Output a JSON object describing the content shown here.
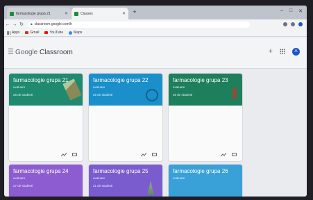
{
  "browser": {
    "tabs": [
      {
        "label": "farmacologie grupa 21",
        "active": false
      },
      {
        "label": "Classes",
        "active": true
      }
    ],
    "url": "classroom.google.com/h",
    "bookmarks": [
      "Apps",
      "Gmail",
      "YouTube",
      "Maps"
    ]
  },
  "header": {
    "app_name_google": "Google",
    "app_name_product": "Classroom",
    "avatar_letter": "A"
  },
  "classes": [
    {
      "title": "farmacologie grupa 21",
      "section": "evaluare",
      "count": "26 de studenti",
      "color": "#1f8a6f"
    },
    {
      "title": "farmacologie grupa 22",
      "section": "evaluare",
      "count": "26 de studenti",
      "color": "#1a8fc9"
    },
    {
      "title": "farmacologie grupa 23",
      "section": "evaluare",
      "count": "28 de studenti",
      "color": "#1e7f5c"
    },
    {
      "title": "farmacologie grupa 24",
      "section": "evaluare",
      "count": "27 de studenti",
      "color": "#8e5cd1"
    },
    {
      "title": "farmacologie grupa 25",
      "section": "evaluare",
      "count": "21 de studenti",
      "color": "#7a5ccf"
    },
    {
      "title": "farmacologie grupa 26",
      "section": "evaluare",
      "count": "",
      "color": "#3aa0d8"
    }
  ]
}
